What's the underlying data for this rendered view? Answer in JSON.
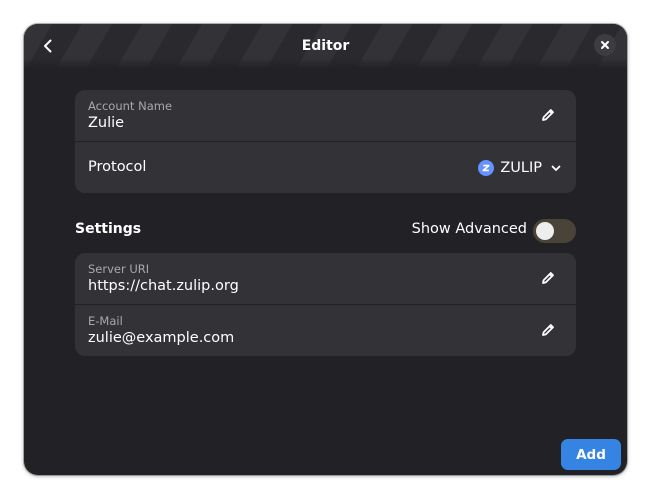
{
  "header": {
    "title": "Editor"
  },
  "account": {
    "name_label": "Account Name",
    "name_value": "Zulie",
    "protocol_label": "Protocol",
    "protocol_value": "ZULIP"
  },
  "settings": {
    "section_title": "Settings",
    "show_advanced_label": "Show Advanced",
    "show_advanced_on": false,
    "server_uri_label": "Server URI",
    "server_uri_value": "https://chat.zulip.org",
    "email_label": "E-Mail",
    "email_value": "zulie@example.com"
  },
  "footer": {
    "add_label": "Add"
  },
  "icons": {
    "back": "back-arrow-icon",
    "close": "close-icon",
    "edit": "pencil-icon",
    "protocol": "zulip-logo-icon",
    "dropdown": "chevron-down-icon"
  },
  "colors": {
    "accent": "#3584e4",
    "zulip_brand": "#6492fe",
    "window_bg": "#222226",
    "card_bg": "#333337"
  }
}
